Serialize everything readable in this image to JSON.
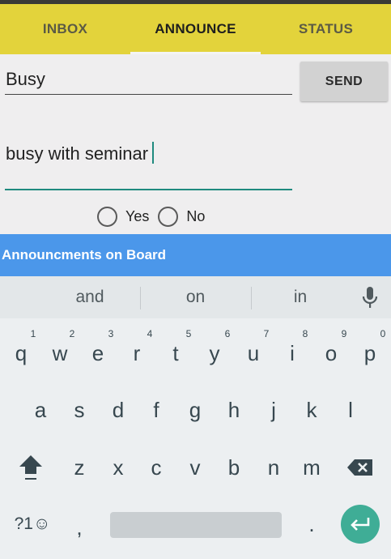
{
  "tabs": [
    {
      "label": "INBOX"
    },
    {
      "label": "ANNOUNCE"
    },
    {
      "label": "STATUS"
    }
  ],
  "form": {
    "title_value": "Busy",
    "message_value": "busy with seminar",
    "send_label": "SEND",
    "radio_yes": "Yes",
    "radio_no": "No"
  },
  "board": {
    "title": "Announcments on Board"
  },
  "keyboard": {
    "suggestions": [
      "and",
      "on",
      "in"
    ],
    "row1": [
      "q",
      "w",
      "e",
      "r",
      "t",
      "y",
      "u",
      "i",
      "o",
      "p"
    ],
    "row1_hints": [
      "1",
      "2",
      "3",
      "4",
      "5",
      "6",
      "7",
      "8",
      "9",
      "0"
    ],
    "row2": [
      "a",
      "s",
      "d",
      "f",
      "g",
      "h",
      "j",
      "k",
      "l"
    ],
    "row3": [
      "z",
      "x",
      "c",
      "v",
      "b",
      "n",
      "m"
    ],
    "symbols_label": "?1☺",
    "comma": ",",
    "period": "."
  },
  "colors": {
    "tab_bar": "#e3d33b",
    "board_banner": "#4b97ea",
    "accent": "#1f8a7e",
    "enter_key": "#3fad96"
  },
  "icons": [
    "mic-icon",
    "shift-icon",
    "backspace-icon",
    "enter-icon"
  ]
}
